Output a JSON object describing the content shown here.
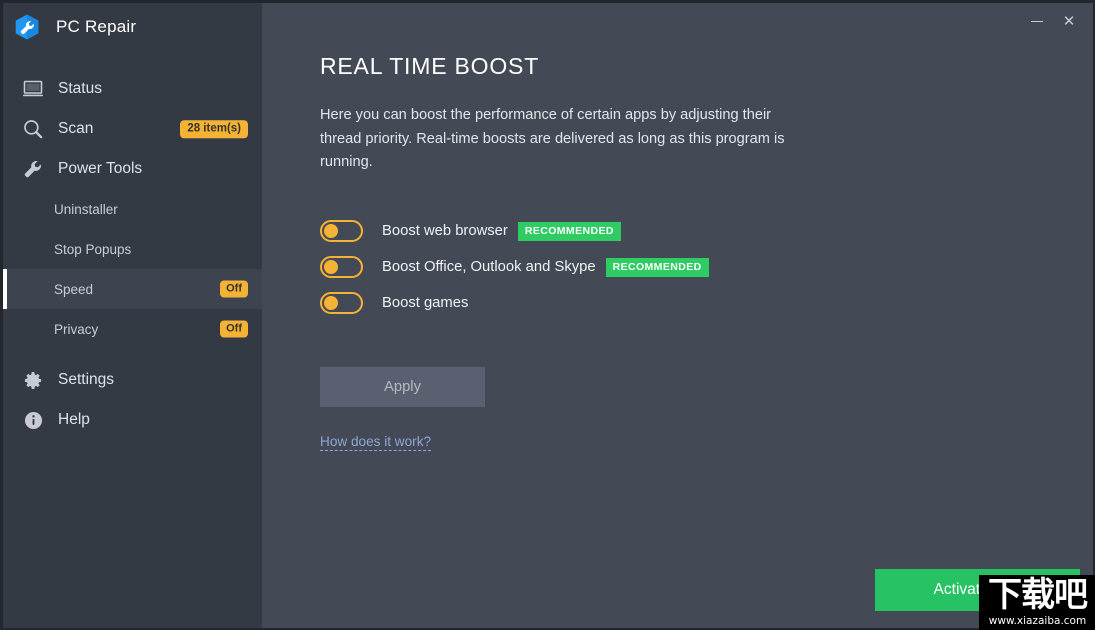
{
  "window": {
    "app_title": "PC Repair",
    "logo_icon": "wrench-hex-icon",
    "minimize_label": "—",
    "close_label": "✕"
  },
  "sidebar": {
    "items": [
      {
        "label": "Status",
        "icon": "monitor-icon",
        "level": "top",
        "badge": null,
        "active": false
      },
      {
        "label": "Scan",
        "icon": "magnifier-icon",
        "level": "top",
        "badge": "28 item(s)",
        "active": false
      },
      {
        "label": "Power Tools",
        "icon": "wrench-icon",
        "level": "top",
        "badge": null,
        "active": false
      },
      {
        "label": "Uninstaller",
        "icon": null,
        "level": "sub",
        "badge": null,
        "active": false
      },
      {
        "label": "Stop Popups",
        "icon": null,
        "level": "sub",
        "badge": null,
        "active": false
      },
      {
        "label": "Speed",
        "icon": null,
        "level": "sub",
        "badge": "Off",
        "active": true
      },
      {
        "label": "Privacy",
        "icon": null,
        "level": "sub",
        "badge": "Off",
        "active": false
      },
      {
        "label": "Settings",
        "icon": "gear-icon",
        "level": "top",
        "badge": null,
        "active": false
      },
      {
        "label": "Help",
        "icon": "info-circle-icon",
        "level": "top",
        "badge": null,
        "active": false
      }
    ]
  },
  "main": {
    "title": "REAL TIME BOOST",
    "description": "Here you can boost the performance of certain apps by adjusting their thread priority. Real-time boosts are delivered as long as this program is running.",
    "toggles": [
      {
        "label": "Boost web browser",
        "state": "off",
        "recommended": true,
        "recommended_label": "RECOMMENDED"
      },
      {
        "label": "Boost Office, Outlook and Skype",
        "state": "off",
        "recommended": true,
        "recommended_label": "RECOMMENDED"
      },
      {
        "label": "Boost games",
        "state": "off",
        "recommended": false,
        "recommended_label": ""
      }
    ],
    "apply_label": "Apply",
    "how_link_label": "How does it work?",
    "activate_label": "Activate now"
  },
  "watermark": {
    "chinese": "下载吧",
    "url": "www.xiazaiba.com"
  },
  "colors": {
    "sidebar_bg": "#343a44",
    "main_bg": "#434955",
    "accent_amber": "#f5b335",
    "accent_green": "#2ecc63",
    "link_blue": "#8fa6d8",
    "active_row": "#3d444f"
  }
}
